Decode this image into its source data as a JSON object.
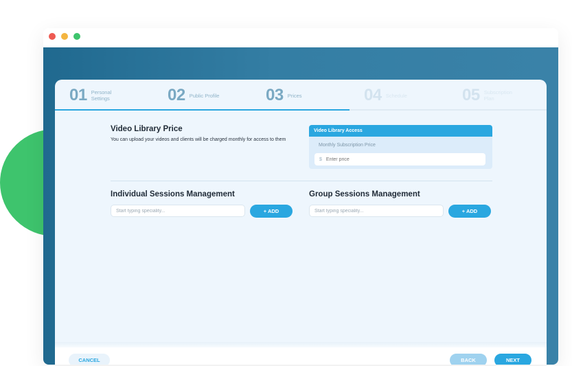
{
  "window": {
    "traffic_lights": [
      "close",
      "minimize",
      "maximize"
    ]
  },
  "steps": [
    {
      "num": "01",
      "label": "Personal Settings",
      "state": "done"
    },
    {
      "num": "02",
      "label": "Public Profile",
      "state": "done"
    },
    {
      "num": "03",
      "label": "Prices",
      "state": "active"
    },
    {
      "num": "04",
      "label": "Schedule",
      "state": "future"
    },
    {
      "num": "05",
      "label": "Subscription Plan",
      "state": "future"
    }
  ],
  "progress": {
    "fraction": 0.6
  },
  "video_library": {
    "title": "Video Library Price",
    "description": "You  can upload your videos and clients will be charged monthly for access to them",
    "access_box": {
      "header": "Video Library Access",
      "subtitle": "Monthly Subscription Price",
      "currency": "$",
      "placeholder": "Enter price",
      "value": ""
    }
  },
  "individual_sessions": {
    "title": "Individual Sessions Management",
    "placeholder": "Start typing speciality...",
    "add_label": "+ ADD"
  },
  "group_sessions": {
    "title": "Group Sessions Management",
    "placeholder": "Start typing speciality...",
    "add_label": "+ ADD"
  },
  "footer": {
    "cancel_label": "CANCEL",
    "back_label": "BACK",
    "next_label": "NEXT"
  },
  "colors": {
    "accent": "#2aa7e0",
    "frame": "#2f7a9f",
    "card_bg": "#eef6fd",
    "decor_circle": "#3ec46d"
  }
}
